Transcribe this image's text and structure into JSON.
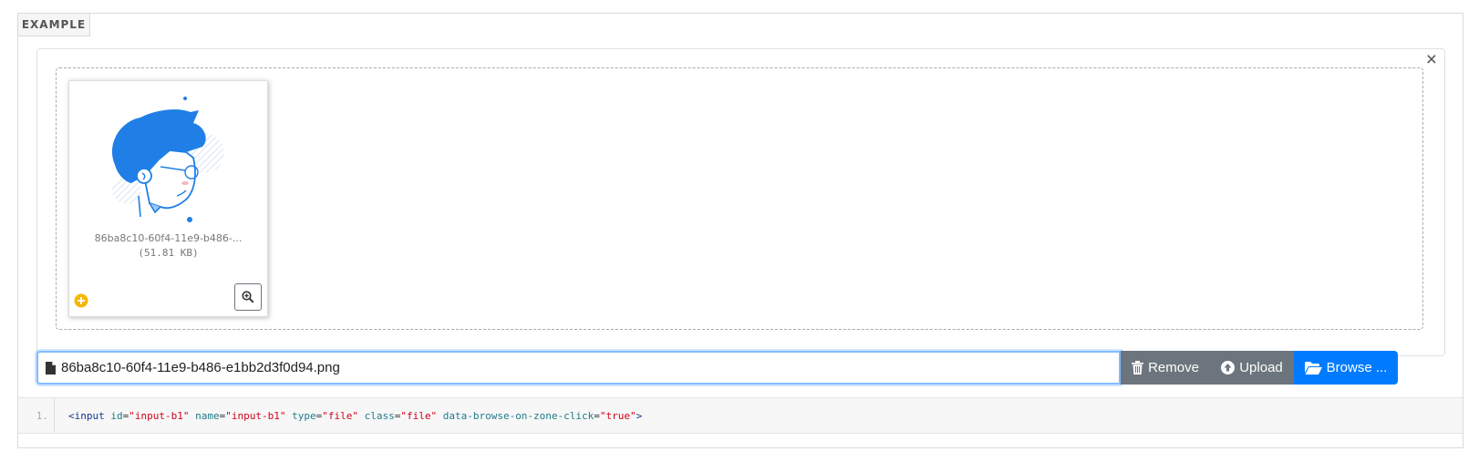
{
  "example_label": "EXAMPLE",
  "close_symbol": "×",
  "thumbnail": {
    "file_name": "86ba8c10-60f4-11e9-b486-...",
    "file_size": "(51.81 KB)",
    "illustration": "user-avatar-illustration"
  },
  "caption": {
    "icon": "file-icon",
    "file_name": "86ba8c10-60f4-11e9-b486-e1bb2d3f0d94.png"
  },
  "buttons": {
    "remove_label": "Remove",
    "upload_label": "Upload",
    "browse_label": "Browse ..."
  },
  "code": {
    "line_number": "1.",
    "tag_open": "<input",
    "attr_id": "id",
    "val_id": "\"input-b1\"",
    "attr_name": "name",
    "val_name": "\"input-b1\"",
    "attr_type": "type",
    "val_type": "\"file\"",
    "attr_class": "class",
    "val_class": "\"file\"",
    "attr_browse": "data-browse-on-zone-click",
    "val_browse": "\"true\"",
    "tag_close": ">"
  },
  "colors": {
    "primary": "#007bff",
    "secondary": "#6c757d",
    "illustration_blue": "#1f7fe6",
    "plus_badge": "#f5b700"
  }
}
